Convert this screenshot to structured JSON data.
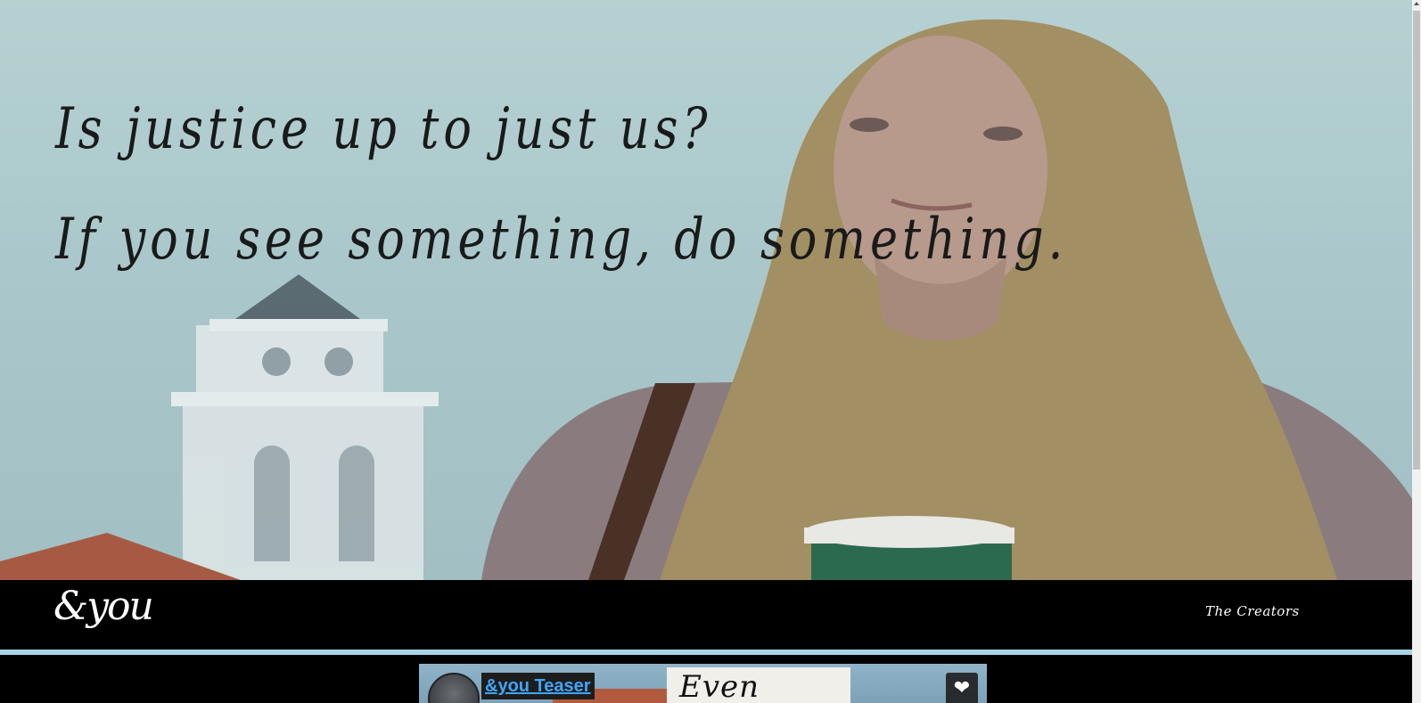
{
  "hero": {
    "headline_line1": "Is justice up to just us?",
    "headline_line2": "If you see something, do something."
  },
  "nav": {
    "logo": "&you",
    "links": [
      {
        "label": "The Creators"
      }
    ]
  },
  "video": {
    "title": "&you Teaser",
    "sign_text": "Even when",
    "like_icon": "heart-icon"
  },
  "colors": {
    "navbar_bg": "#000000",
    "divider": "#a9d4e6",
    "video_title_link": "#3ea6ff",
    "hero_sky": "#b6d1d2"
  }
}
